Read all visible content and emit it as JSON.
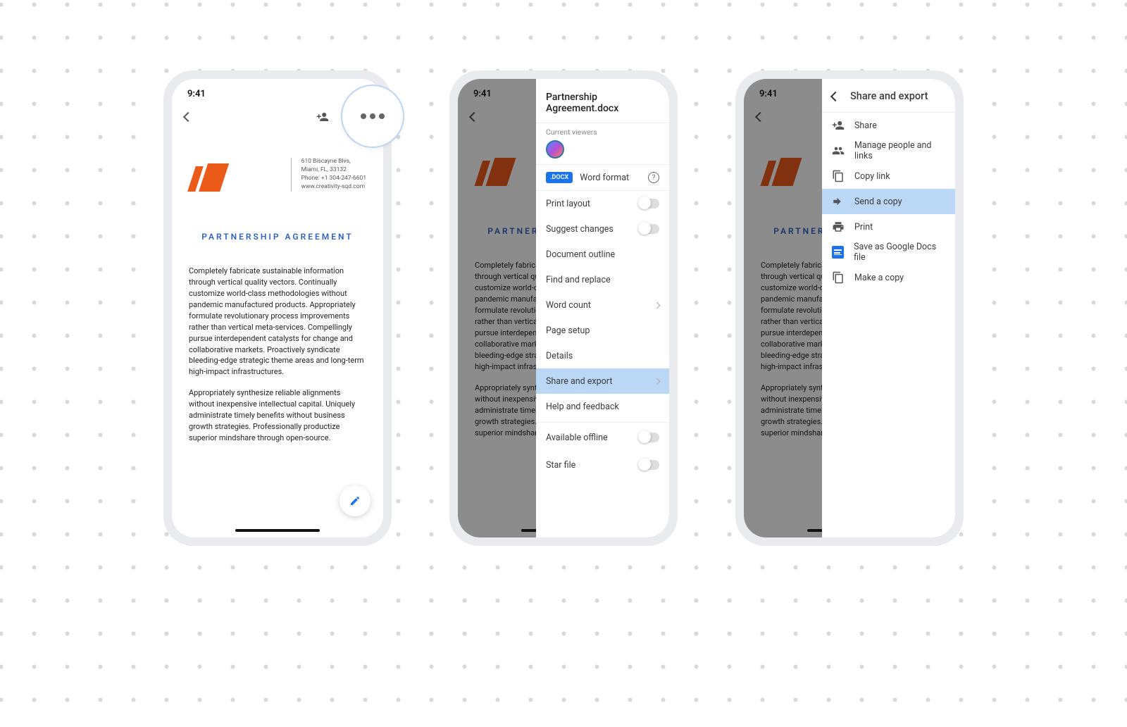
{
  "status": {
    "time": "9:41"
  },
  "doc": {
    "contact": {
      "addr1": "610 Biscayne Blvs,",
      "addr2": "Miami, FL, 33132",
      "phone": "Phone: +1 304-247-6601",
      "site": "www.creativity-sqd.com"
    },
    "title": "PARTNERSHIP AGREEMENT",
    "para1": "Completely fabricate sustainable information through vertical quality vectors. Continually customize world-class methodologies without pandemic manufactured products. Appropriately formulate revolutionary process improvements rather than vertical meta-services. Compellingly pursue interdependent catalysts for change and collaborative markets. Proactively syndicate bleeding-edge strategic theme areas and long-term high-impact infrastructures.",
    "para2": "Appropriately synthesize reliable alignments without inexpensive intellectual capital. Uniquely administrate timely benefits without business growth strategies. Professionally productize superior mindshare through open-source."
  },
  "panel1": {
    "filename": "Partnership Agreement.docx",
    "viewers": "Current viewers",
    "badge": ".DOCX",
    "format": "Word format",
    "items": {
      "print_layout": "Print layout",
      "suggest": "Suggest changes",
      "outline": "Document outline",
      "find": "Find and replace",
      "words": "Word count",
      "page_setup": "Page setup",
      "details": "Details",
      "share_export": "Share and export",
      "help": "Help and feedback",
      "offline": "Available offline",
      "star": "Star file"
    }
  },
  "panel2": {
    "title": "Share and export",
    "items": {
      "share": "Share",
      "manage": "Manage people and links",
      "copy": "Copy link",
      "send": "Send a copy",
      "print": "Print",
      "save_docs": "Save as Google Docs file",
      "make_copy": "Make a copy"
    }
  }
}
